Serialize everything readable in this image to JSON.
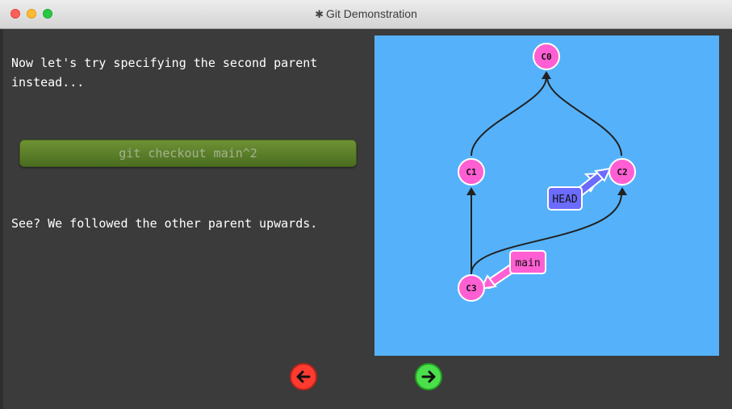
{
  "window": {
    "title": "Git Demonstration"
  },
  "left": {
    "paragraph1": "Now let's try specifying the second parent instead...",
    "command": "git checkout main^2",
    "paragraph2": "See? We followed the other parent upwards."
  },
  "graph": {
    "commits": [
      "C0",
      "C1",
      "C2",
      "C3"
    ],
    "branches": {
      "head": "HEAD",
      "main": "main"
    },
    "colors": {
      "background": "#55b2fa",
      "commit": "#ff5fd2",
      "head": "#6b6bff",
      "main": "#ff5fd2"
    }
  },
  "nav": {
    "back_icon": "arrow-left-icon",
    "forward_icon": "arrow-right-icon"
  }
}
